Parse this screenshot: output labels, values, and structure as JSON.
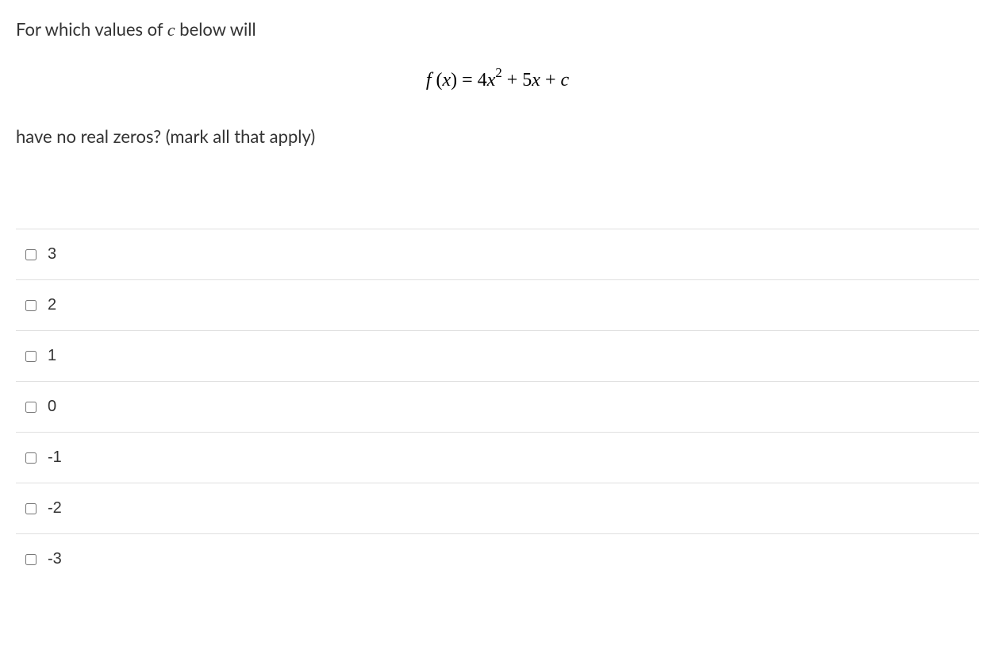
{
  "question": {
    "line1_part1": "For which values of ",
    "line1_var": "c",
    "line1_part2": " below will",
    "equation_html": "<span class='mi'>f</span> (<span class='mi'>x</span>) = 4<span class='mi'>x</span><span class='sup'>2</span> + 5<span class='mi'>x</span> + <span class='mi'>c</span>",
    "line2": "have no real zeros?  (mark all that apply)"
  },
  "options": [
    {
      "label": "3"
    },
    {
      "label": "2"
    },
    {
      "label": "1"
    },
    {
      "label": "0"
    },
    {
      "label": "-1"
    },
    {
      "label": "-2"
    },
    {
      "label": "-3"
    }
  ]
}
